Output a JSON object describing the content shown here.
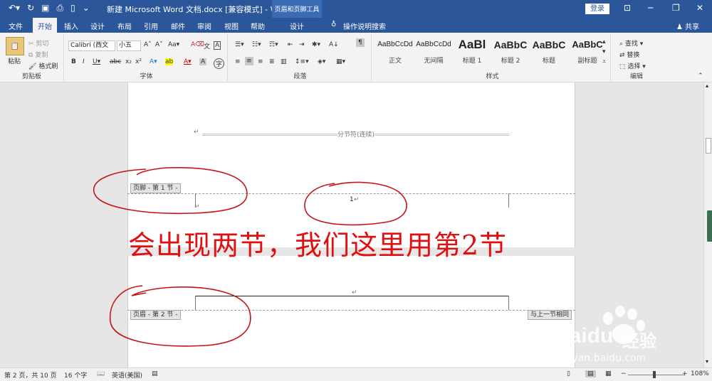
{
  "title": {
    "doc": "新建 Microsoft Word 文档.docx [兼容模式] - Word",
    "context_tool": "页眉和页脚工具",
    "login": "登录"
  },
  "tabs": [
    {
      "label": "文件"
    },
    {
      "label": "开始"
    },
    {
      "label": "插入"
    },
    {
      "label": "设计"
    },
    {
      "label": "布局"
    },
    {
      "label": "引用"
    },
    {
      "label": "邮件"
    },
    {
      "label": "审阅"
    },
    {
      "label": "视图"
    },
    {
      "label": "帮助"
    },
    {
      "label": "设计"
    }
  ],
  "tell_me": "操作说明搜索",
  "share": "共享",
  "clipboard": {
    "paste": "粘贴",
    "cut": "剪切",
    "copy": "复制",
    "format_painter": "格式刷",
    "label": "剪贴板"
  },
  "font": {
    "name": "Calibri (西文",
    "size": "小五",
    "label": "字体"
  },
  "paragraph": {
    "label": "段落"
  },
  "styles": {
    "items": [
      {
        "preview": "AaBbCcDd",
        "name": "正文"
      },
      {
        "preview": "AaBbCcDd",
        "name": "无间隔"
      },
      {
        "preview": "AaBl",
        "name": "标题 1"
      },
      {
        "preview": "AaBbC",
        "name": "标题 2"
      },
      {
        "preview": "AaBbC",
        "name": "标题"
      },
      {
        "preview": "AaBbC",
        "name": "副标题"
      }
    ],
    "label": "样式"
  },
  "editing": {
    "find": "查找",
    "replace": "替换",
    "select": "选择",
    "label": "编辑"
  },
  "document": {
    "section_break": "分节符(连续)",
    "footer_tag": "页脚 - 第 1 节 -",
    "page_number": "1",
    "header_tag": "页眉 - 第 2 节 -",
    "same_as_prev": "与上一节相同",
    "annotation": "会出现两节，我们这里用第2节"
  },
  "status": {
    "page": "第 2 页，共 10 页",
    "words": "16 个字",
    "lang": "英语(美国)",
    "zoom": "108%"
  },
  "watermark": {
    "brand": "Baidu",
    "brand_cn": "经验",
    "url": "jingyan.baidu.com"
  }
}
